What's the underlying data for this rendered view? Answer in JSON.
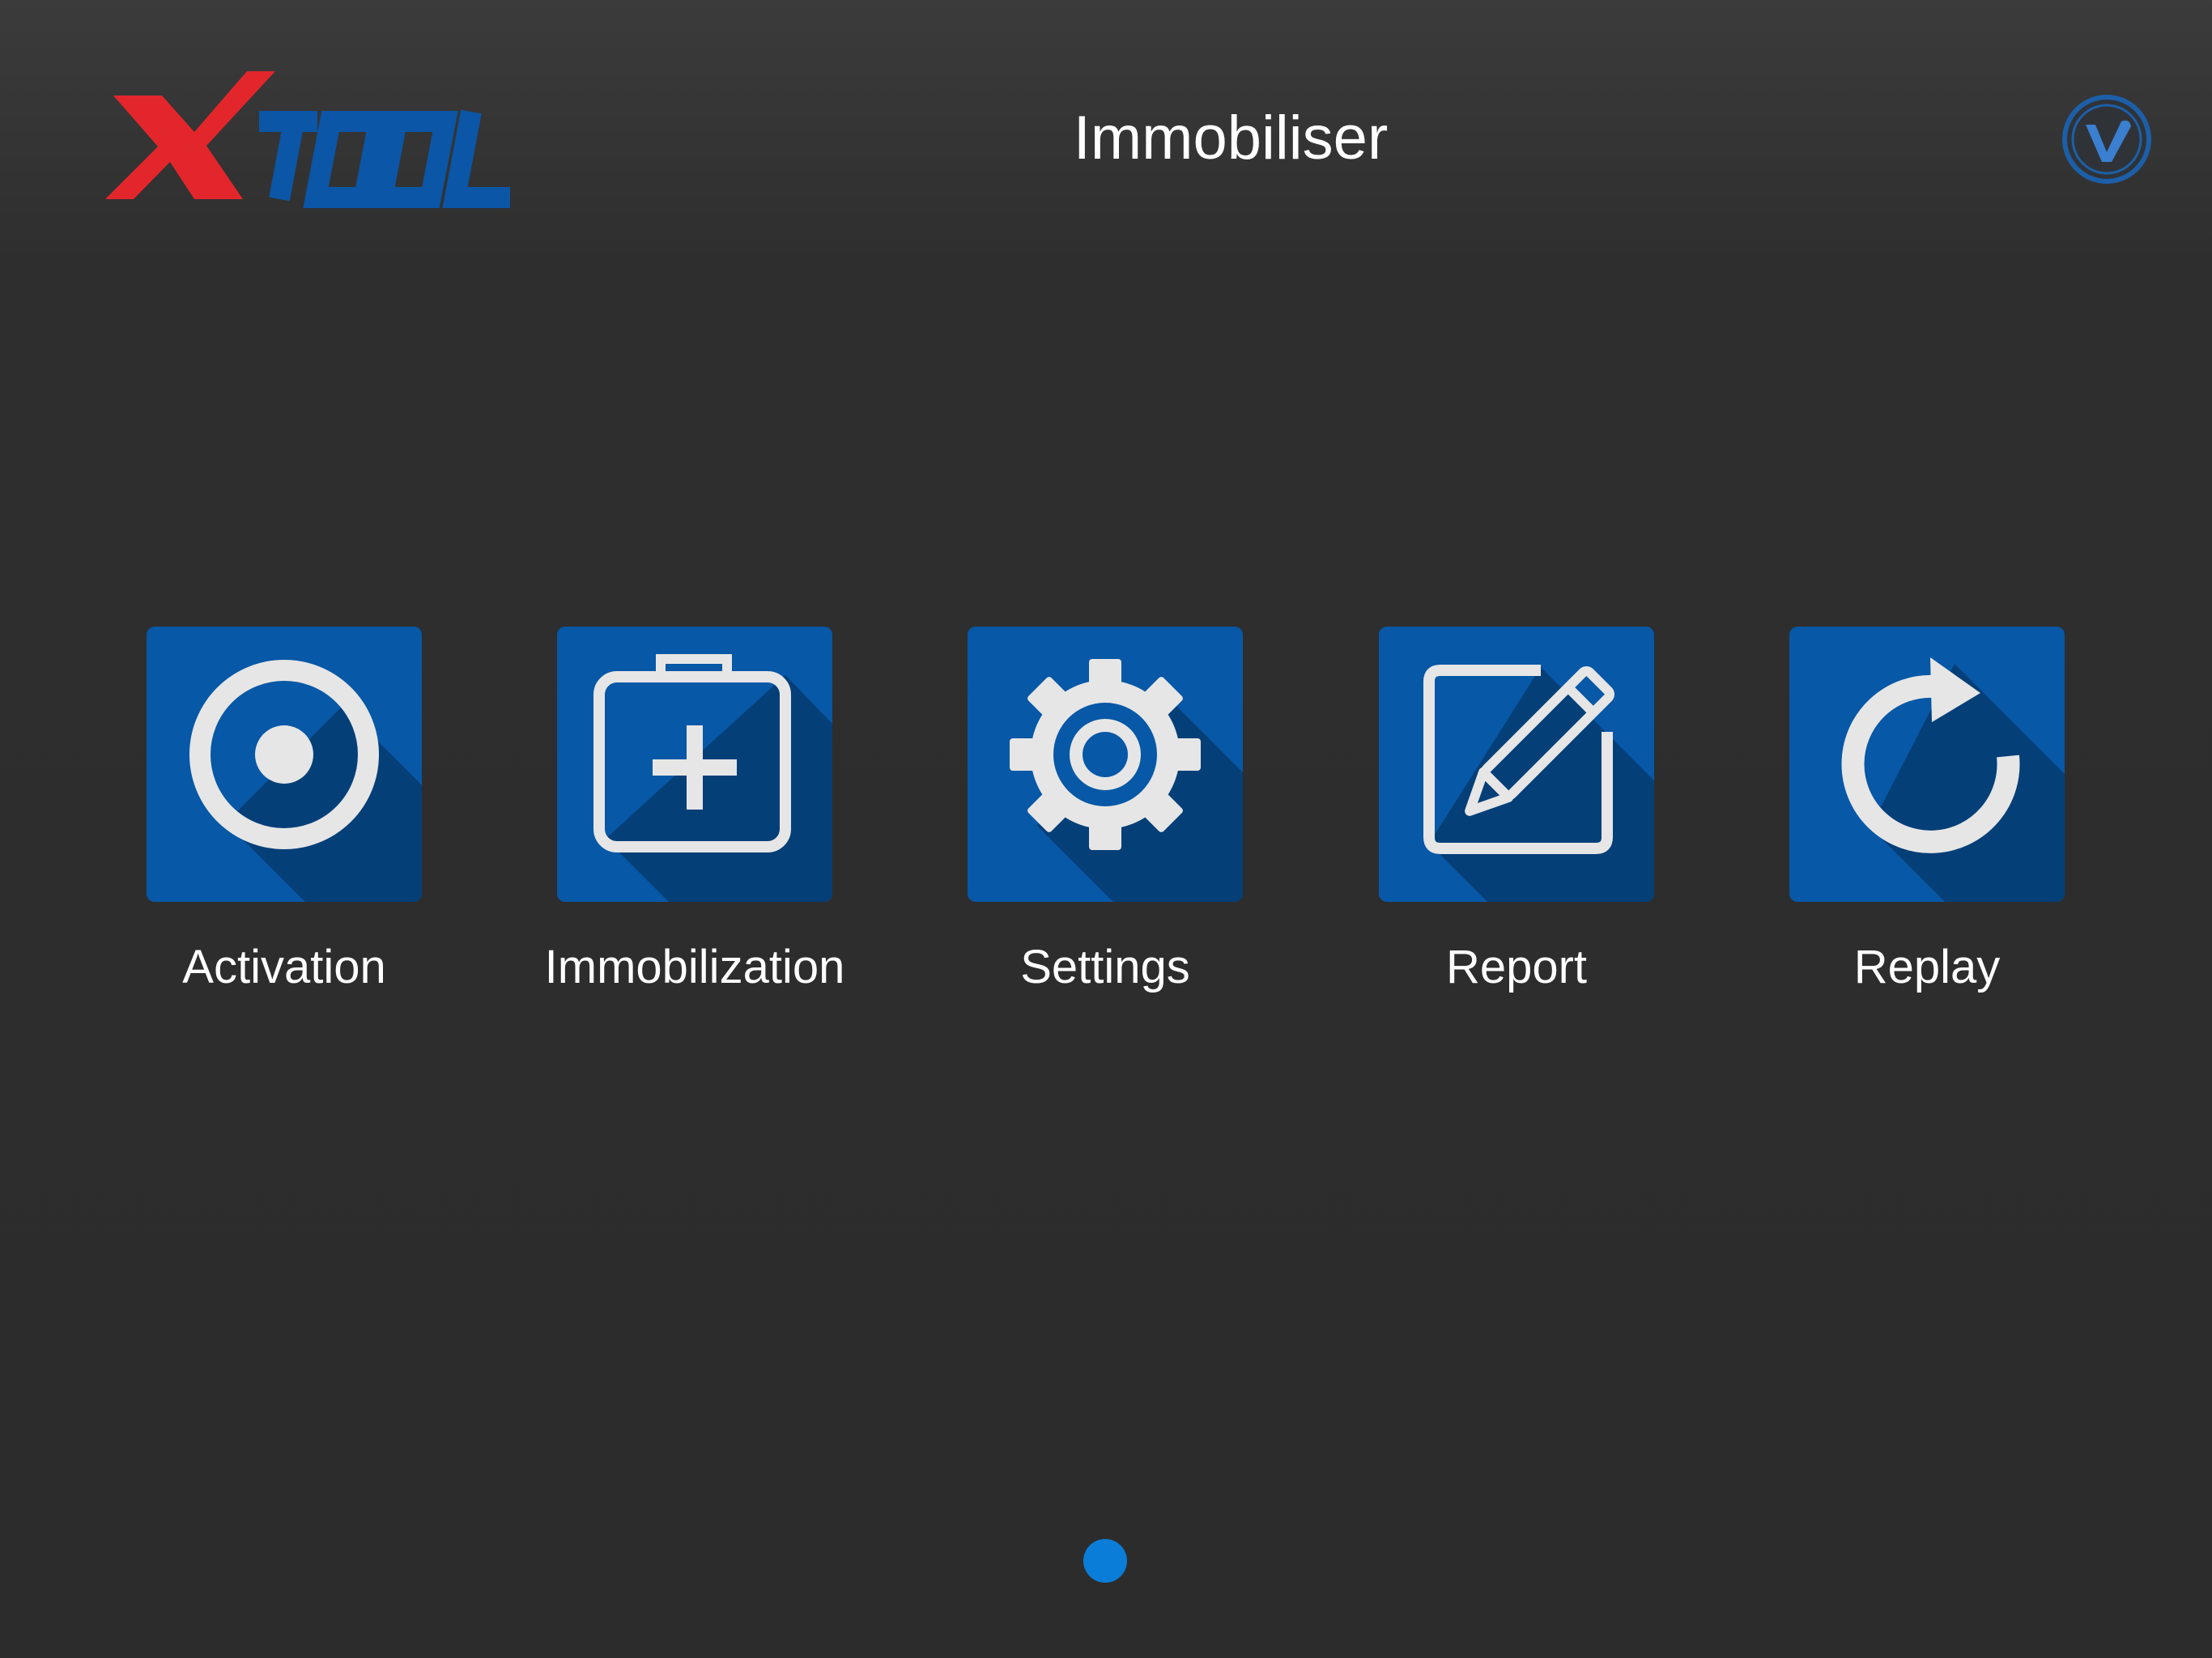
{
  "header": {
    "logo_text": "XTOOL",
    "title": "Immobiliser",
    "vci_icon": "vci-status-icon"
  },
  "colors": {
    "background": "#2d2d2d",
    "tile": "#0758a6",
    "tile_shadow": "#053f78",
    "icon_glyph": "#e6e6e6",
    "logo_red": "#e3262b",
    "logo_blue": "#0b56a6",
    "page_dot": "#0a7dd8"
  },
  "menu": {
    "items": [
      {
        "label": "Activation",
        "icon": "target-icon"
      },
      {
        "label": "Immobilization",
        "icon": "medical-kit-icon"
      },
      {
        "label": "Settings",
        "icon": "gear-icon"
      },
      {
        "label": "Report",
        "icon": "edit-note-icon"
      },
      {
        "label": "Replay",
        "icon": "refresh-icon"
      }
    ]
  },
  "pagination": {
    "pages": 1,
    "current": 1
  }
}
